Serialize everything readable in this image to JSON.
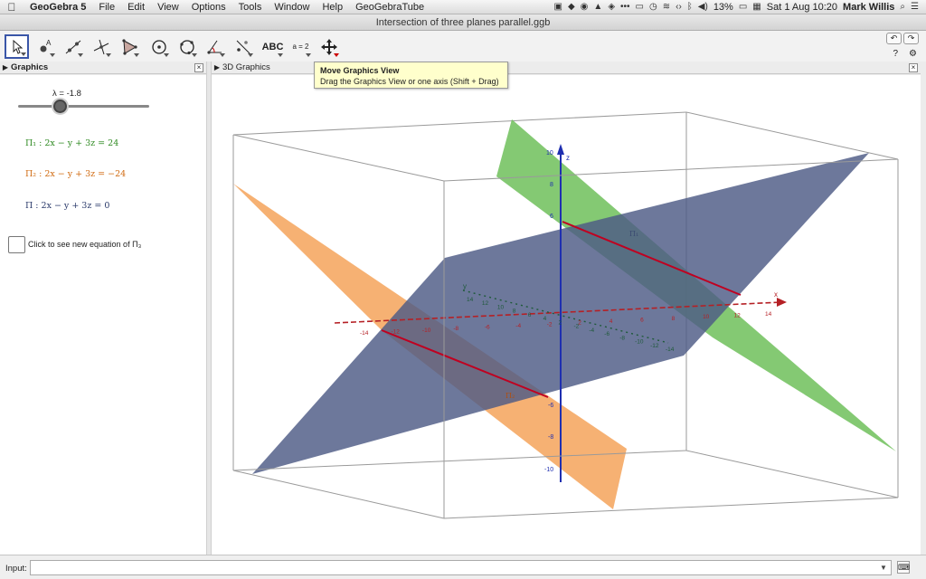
{
  "menubar": {
    "app_name": "GeoGebra 5",
    "items": [
      "File",
      "Edit",
      "View",
      "Options",
      "Tools",
      "Window",
      "Help",
      "GeoGebraTube"
    ],
    "battery": "13%",
    "datetime": "Sat 1 Aug  10:20",
    "user": "Mark Willis"
  },
  "window": {
    "title": "Intersection of three planes parallel.ggb"
  },
  "toolbar": {
    "tools": [
      {
        "name": "move-tool",
        "active": true
      },
      {
        "name": "point-tool"
      },
      {
        "name": "line-tool"
      },
      {
        "name": "perpendicular-line-tool"
      },
      {
        "name": "polygon-tool"
      },
      {
        "name": "circle-tool"
      },
      {
        "name": "circle-through-points-tool"
      },
      {
        "name": "angle-tool"
      },
      {
        "name": "reflect-tool"
      },
      {
        "name": "text-tool",
        "label": "ABC"
      },
      {
        "name": "slider-tool",
        "label": "a = 2"
      },
      {
        "name": "move-graphics-view-tool"
      }
    ],
    "help_label": "?",
    "settings_icon": "gear-icon"
  },
  "tooltip": {
    "title": "Move Graphics View",
    "body": "Drag the Graphics View or one axis (Shift + Drag)"
  },
  "panels": {
    "left_title": "Graphics",
    "right_title": "3D Graphics"
  },
  "algebra": {
    "slider_label": "λ = -1.8",
    "slider_value": -1.8,
    "eq1": "Π₁ :  2x − y + 3z = 24",
    "eq2": "Π₂ :  2x − y + 3z = −24",
    "eq3": "Π :  2x − y + 3z = 0",
    "checkbox_label": "Click to see new equation of Π₃"
  },
  "view3d": {
    "z_label": "z",
    "x_label": "x",
    "y_label": "y",
    "plane1_label": "Π₁",
    "plane2_label": "Π₂",
    "z_ticks": [
      "10",
      "8",
      "6",
      "-6",
      "-8",
      "-10"
    ],
    "x_ticks": [
      "-14",
      "-12",
      "-10",
      "-8",
      "-6",
      "-4",
      "-2",
      "2",
      "4",
      "6",
      "8",
      "10",
      "12",
      "14"
    ],
    "y_ticks": [
      "14",
      "12",
      "10",
      "8",
      "6",
      "4",
      "2",
      "-2",
      "-4",
      "-6",
      "-8",
      "-10",
      "-12",
      "-14"
    ],
    "colors": {
      "plane_green": "#6ec05a",
      "plane_orange": "#f5a35a",
      "plane_blue": "#4d5a85",
      "axis_x": "#b52025",
      "axis_y": "#1f5a3a",
      "axis_z": "#1f2fb0",
      "intersection": "#c00020"
    }
  },
  "inputbar": {
    "label": "Input:",
    "value": ""
  }
}
